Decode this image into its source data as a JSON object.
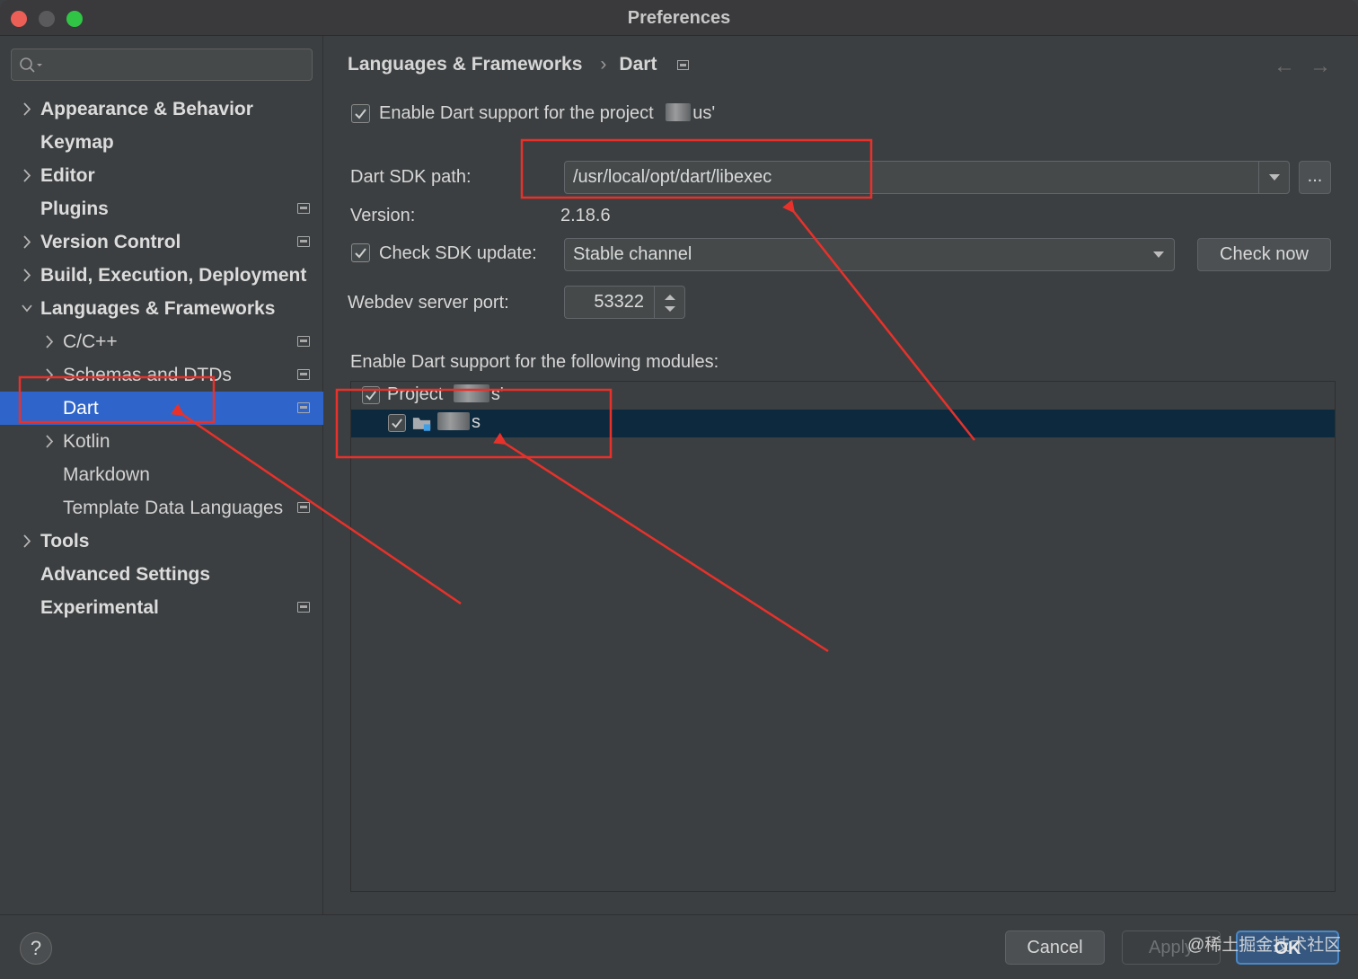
{
  "window": {
    "title": "Preferences"
  },
  "sidebar": {
    "search_placeholder": "",
    "items": [
      {
        "label": "Appearance & Behavior",
        "bold": true,
        "chevron": "right",
        "indent": 0,
        "project_icon": false
      },
      {
        "label": "Keymap",
        "bold": true,
        "chevron": "none",
        "indent": 0,
        "project_icon": false
      },
      {
        "label": "Editor",
        "bold": true,
        "chevron": "right",
        "indent": 0,
        "project_icon": false
      },
      {
        "label": "Plugins",
        "bold": true,
        "chevron": "none",
        "indent": 0,
        "project_icon": true
      },
      {
        "label": "Version Control",
        "bold": true,
        "chevron": "right",
        "indent": 0,
        "project_icon": true
      },
      {
        "label": "Build, Execution, Deployment",
        "bold": true,
        "chevron": "right",
        "indent": 0,
        "project_icon": false
      },
      {
        "label": "Languages & Frameworks",
        "bold": true,
        "chevron": "down",
        "indent": 0,
        "project_icon": false
      },
      {
        "label": "C/C++",
        "bold": false,
        "chevron": "right",
        "indent": 1,
        "project_icon": true
      },
      {
        "label": "Schemas and DTDs",
        "bold": false,
        "chevron": "right",
        "indent": 1,
        "project_icon": true
      },
      {
        "label": "Dart",
        "bold": false,
        "chevron": "none",
        "indent": 1,
        "project_icon": true,
        "selected": true
      },
      {
        "label": "Kotlin",
        "bold": false,
        "chevron": "right",
        "indent": 1,
        "project_icon": false
      },
      {
        "label": "Markdown",
        "bold": false,
        "chevron": "none",
        "indent": 1,
        "project_icon": false
      },
      {
        "label": "Template Data Languages",
        "bold": false,
        "chevron": "none",
        "indent": 1,
        "project_icon": true
      },
      {
        "label": "Tools",
        "bold": true,
        "chevron": "right",
        "indent": 0,
        "project_icon": false
      },
      {
        "label": "Advanced Settings",
        "bold": true,
        "chevron": "none",
        "indent": 0,
        "project_icon": false
      },
      {
        "label": "Experimental",
        "bold": true,
        "chevron": "none",
        "indent": 0,
        "project_icon": true
      }
    ]
  },
  "breadcrumb": {
    "parent": "Languages & Frameworks",
    "separator": "›",
    "current": "Dart"
  },
  "dart": {
    "enable_project_label": "Enable Dart support for the project",
    "enable_project_suffix": "us'",
    "enable_project_checked": true,
    "sdk_path_label": "Dart SDK path:",
    "sdk_path_value": "/usr/local/opt/dart/libexec",
    "browse_label": "...",
    "version_label": "Version:",
    "version_value": "2.18.6",
    "check_sdk_update_label": "Check SDK update:",
    "check_sdk_update_checked": true,
    "update_channel": "Stable channel",
    "check_now_label": "Check now",
    "webdev_port_label": "Webdev server port:",
    "webdev_port_value": "53322",
    "modules_label": "Enable Dart support for the following modules:",
    "modules": [
      {
        "label_prefix": "Project",
        "label_suffix": "s'",
        "checked": true,
        "type": "project"
      },
      {
        "label_prefix": "",
        "label_suffix": "s",
        "checked": true,
        "type": "module",
        "selected": true
      }
    ]
  },
  "footer": {
    "help_label": "?",
    "cancel_label": "Cancel",
    "apply_label": "Apply",
    "ok_label": "OK",
    "watermark": "@稀土掘金技术社区"
  },
  "colors": {
    "selection": "#2f65ca",
    "tree_selection": "#0d293e",
    "annotation": "#e8312b",
    "ok_border": "#4a88c7"
  }
}
